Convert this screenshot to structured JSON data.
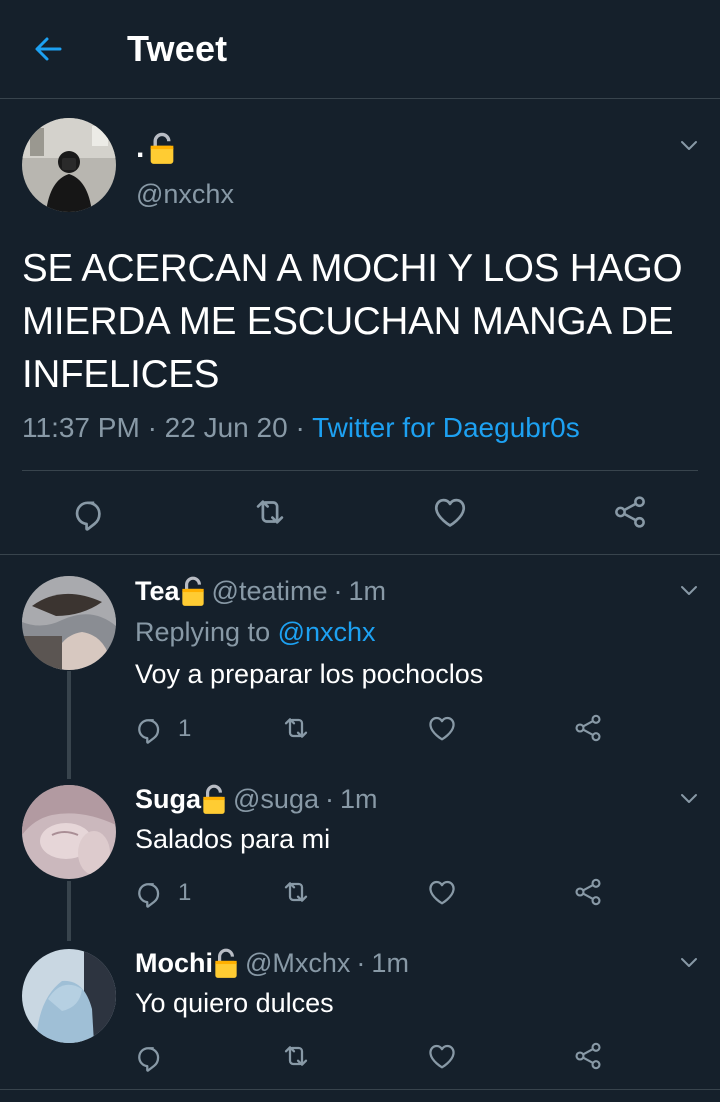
{
  "header": {
    "title": "Tweet",
    "back_icon": "arrow-left-icon",
    "accent": "#1da1f2"
  },
  "tweet": {
    "name": ".",
    "name_icon": "lock-icon",
    "handle": "@nxchx",
    "text": "SE ACERCAN A MOCHI Y LOS HAGO MIERDA ME ESCUCHAN MANGA DE INFELICES",
    "time": "11:37 PM",
    "date": "22 Jun 20",
    "source": "Twitter for Daegubr0s",
    "actions": [
      "reply-icon",
      "retweet-icon",
      "like-icon",
      "share-icon"
    ]
  },
  "replies": [
    {
      "name": "Tea",
      "handle": "@teatime",
      "time": "1m",
      "replying_label": "Replying to",
      "replying_to": "@nxchx",
      "text": "Voy a preparar los pochoclos",
      "reply_count": "1"
    },
    {
      "name": "Suga",
      "handle": "@suga",
      "time": "1m",
      "text": "Salados para mi",
      "reply_count": "1"
    },
    {
      "name": "Mochi",
      "handle": "@Mxchx",
      "time": "1m",
      "text": "Yo quiero dulces",
      "reply_count": ""
    }
  ],
  "separators": {
    "dot": "·"
  },
  "colors": {
    "background": "#15202b",
    "border": "#38444d",
    "muted": "#8899a6",
    "lock": "#ffcc33"
  }
}
